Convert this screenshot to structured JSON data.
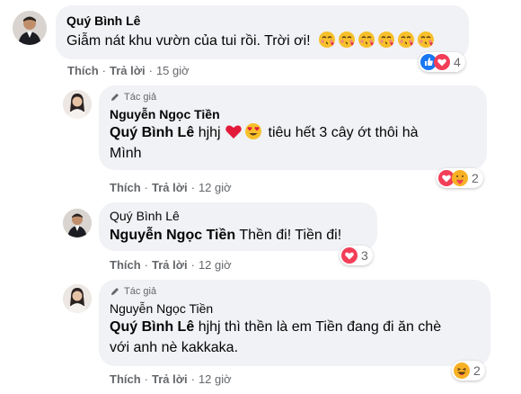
{
  "comments": [
    {
      "author": "Quý Bình Lê",
      "text": "Giẫm nát khu vườn của tui rồi. Trời ơi!",
      "actions": {
        "like": "Thích",
        "reply": "Trả lời",
        "time": "15 giờ"
      },
      "reaction_count": "4",
      "reaction_icons": [
        "like-icon",
        "love-icon"
      ],
      "emojis": [
        "kissing-emoji",
        "kissing-emoji",
        "kissing-emoji",
        "kissing-emoji",
        "kissing-emoji",
        "kissing-emoji"
      ]
    },
    {
      "author_tag": "Tác giả",
      "author": "Nguyễn Ngọc Tiền",
      "mention": "Quý Bình Lê",
      "text_a": "hjhj",
      "text_b": "tiêu hết 3 cây ớt thôi hà",
      "text_c": "Mình",
      "actions": {
        "like": "Thích",
        "reply": "Trả lời",
        "time": "12 giờ"
      },
      "reaction_count": "2",
      "reaction_icons": [
        "love-icon",
        "care-icon"
      ]
    },
    {
      "author": "Quý Bình Lê",
      "mention": "Nguyễn Ngọc Tiền",
      "text": "Thền đi! Tiền đi!",
      "actions": {
        "like": "Thích",
        "reply": "Trả lời",
        "time": "12 giờ"
      },
      "reaction_count": "3",
      "reaction_icons": [
        "love-icon"
      ]
    },
    {
      "author_tag": "Tác giả",
      "author": "Nguyễn Ngọc Tiền",
      "mention": "Quý Bình Lê",
      "text_a": "hjhj thì thền là em Tiền đang đi ăn chè",
      "text_b": "với anh nè kakkaka.",
      "actions": {
        "like": "Thích",
        "reply": "Trả lời",
        "time": "12 giờ"
      },
      "reaction_count": "2",
      "reaction_icons": [
        "haha-icon"
      ]
    }
  ],
  "separator": "·",
  "colors": {
    "like": "#1877f2",
    "love": "#f33e58",
    "haha": "#f7b125",
    "bubble": "#f0f2f5",
    "meta": "#65676b"
  }
}
